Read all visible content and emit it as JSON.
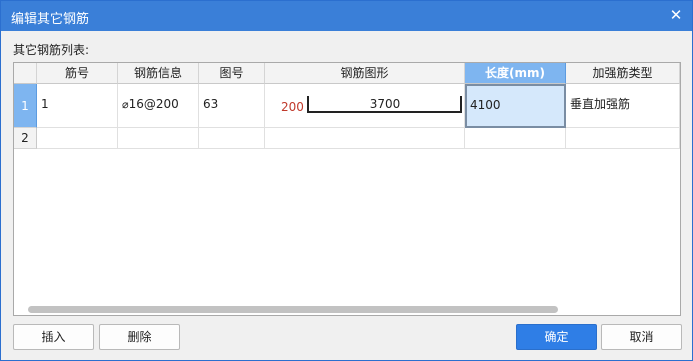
{
  "dialog": {
    "title": "编辑其它钢筋",
    "close_glyph": "✕",
    "list_label": "其它钢筋列表:"
  },
  "table": {
    "columns": [
      "筋号",
      "钢筋信息",
      "图号",
      "钢筋图形",
      "长度(mm)",
      "加强筋类型"
    ],
    "rows": [
      {
        "row_number": "1",
        "bar_number": "1",
        "rebar_symbol": "⌀",
        "rebar_info": "16@200",
        "shape_no": "63",
        "shape_hook_label": "200",
        "shape_length_label": "3700",
        "length": "4100",
        "reinforcement_type": "垂直加强筋"
      },
      {
        "row_number": "2",
        "bar_number": "",
        "rebar_symbol": "",
        "rebar_info": "",
        "shape_no": "",
        "shape_hook_label": "",
        "shape_length_label": "",
        "length": "",
        "reinforcement_type": ""
      }
    ]
  },
  "buttons": {
    "insert": "插入",
    "delete": "删除",
    "ok": "确定",
    "cancel": "取消"
  },
  "colors": {
    "titlebar": "#3a7fd8",
    "selected_header": "#7eb5f0",
    "focus_cell": "#d5e8fb",
    "primary_button": "#2f7ee6",
    "hook_label": "#c0392b"
  }
}
